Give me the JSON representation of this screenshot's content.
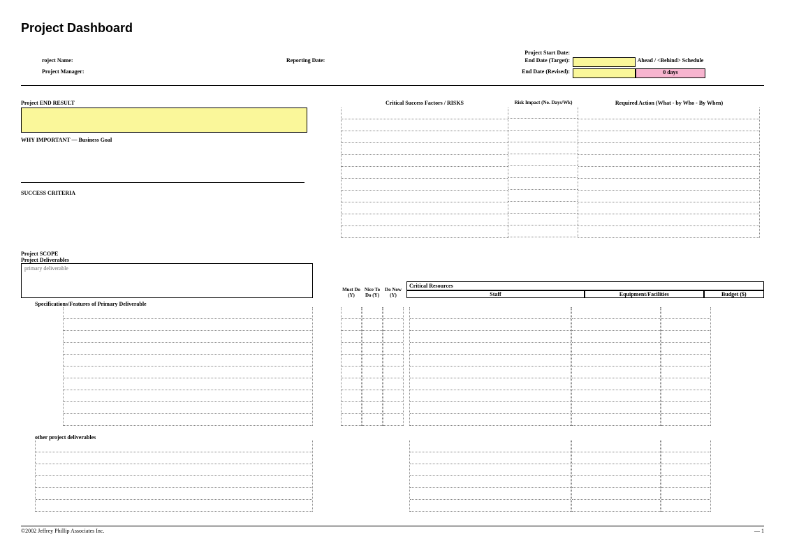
{
  "title": "Project Dashboard",
  "header": {
    "project_name_label": "roject Name:",
    "reporting_date_label": "Reporting Date:",
    "project_start_date_label": "Project Start Date:",
    "project_manager_label": "Project Manager:",
    "end_date_target_label": "End Date (Target):",
    "end_date_revised_label": "End Date (Revised):",
    "ahead_behind_label": "Ahead / <Behind> Schedule",
    "days_value": "0 days"
  },
  "mid": {
    "end_result_label": "Project END RESULT",
    "why_label": "WHY IMPORTANT  —  Business Goal",
    "success_label": "SUCCESS CRITERIA",
    "csf_label": "Critical Success Factors / RISKS",
    "risk_impact_label": "Risk Impact (No. Days/Wk)",
    "required_action_label": "Required Action  (What - by Who - By When)"
  },
  "scope": {
    "scope_label": "Project SCOPE",
    "deliverables_label": "Project Deliverables",
    "primary_placeholder": "primary deliverable",
    "must_do": "Must Do (Y)",
    "nice_to_do": "Nice To Do (Y)",
    "do_now": "Do Now (Y)",
    "critical_resources": "Critical Resources",
    "staff": "Staff",
    "equipment": "Equipment/Facilities",
    "budget": "Budget ($)",
    "spec_label": "Specifications/Features of Primary Deliverable",
    "other_label": "other project deliverables"
  },
  "footer": {
    "copyright": "©2002 Jeffrey Phillip Associates Inc.",
    "page": "— 1"
  }
}
